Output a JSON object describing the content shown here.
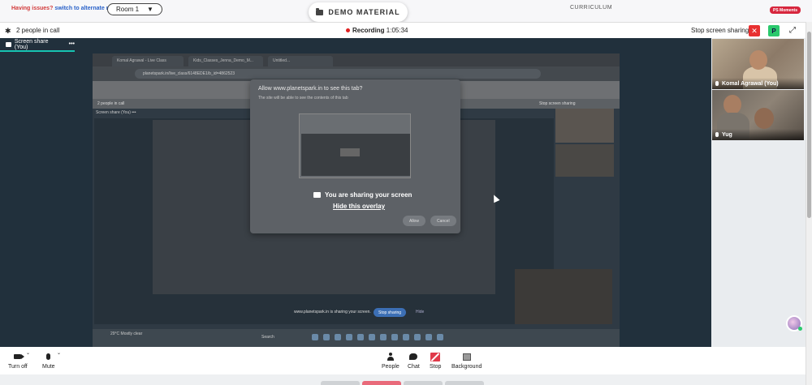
{
  "top": {
    "issues_text": "Having issues?",
    "alternate_link": "switch to alternate room",
    "room_select": "Room 1",
    "demo_material": "DEMO MATERIAL",
    "curriculum": "CURRICULUM",
    "moments_badge": "PS Moments"
  },
  "callbar": {
    "people_count": "2 people in call",
    "recording_label": "Recording",
    "recording_time": "1:05:34",
    "stop_sharing": "Stop screen sharing",
    "p_button": "P",
    "close_icon": "x-icon",
    "expand_icon": "expand-icon"
  },
  "stage": {
    "tab_label": "Screen share (You)",
    "tab_menu": "•••",
    "sharing_notice": "You are sharing your screen",
    "hide_overlay": "Hide this overlay"
  },
  "shared_screen": {
    "browser_tab1": "Komal Agrawal - Live Class",
    "browser_tab2": "Kids_Classes_Jenna_Demo_M...",
    "browser_tab3": "Untitled...",
    "url": "planetspark.in/live_class/6148EDE1/b_id=4862523",
    "inner_people": "2 people in call",
    "inner_share_tab": "Screen share (You) •••",
    "dialog_title": "Allow www.planetspark.in to see this tab?",
    "dialog_sub": "The site will be able to see the contents of this tab",
    "dialog_allow": "Allow",
    "dialog_cancel": "Cancel",
    "inner_stop": "Stop screen sharing",
    "inner_sharing_bar": "www.planetspark.in is sharing your screen.",
    "inner_stop_btn": "Stop sharing",
    "inner_hide": "Hide",
    "taskbar_search": "Search",
    "taskbar_weather": "29°C Mostly clear"
  },
  "participants": [
    {
      "name": "Komal Agrawal (You)"
    },
    {
      "name": "Yug"
    }
  ],
  "controls": {
    "turn_off": "Turn off",
    "mute": "Mute",
    "people": "People",
    "chat": "Chat",
    "stop": "Stop",
    "background": "Background"
  },
  "colors": {
    "accent_teal": "#17c3b2",
    "record_red": "#e02020",
    "stop_red": "#e83030",
    "green": "#2bc96d"
  }
}
